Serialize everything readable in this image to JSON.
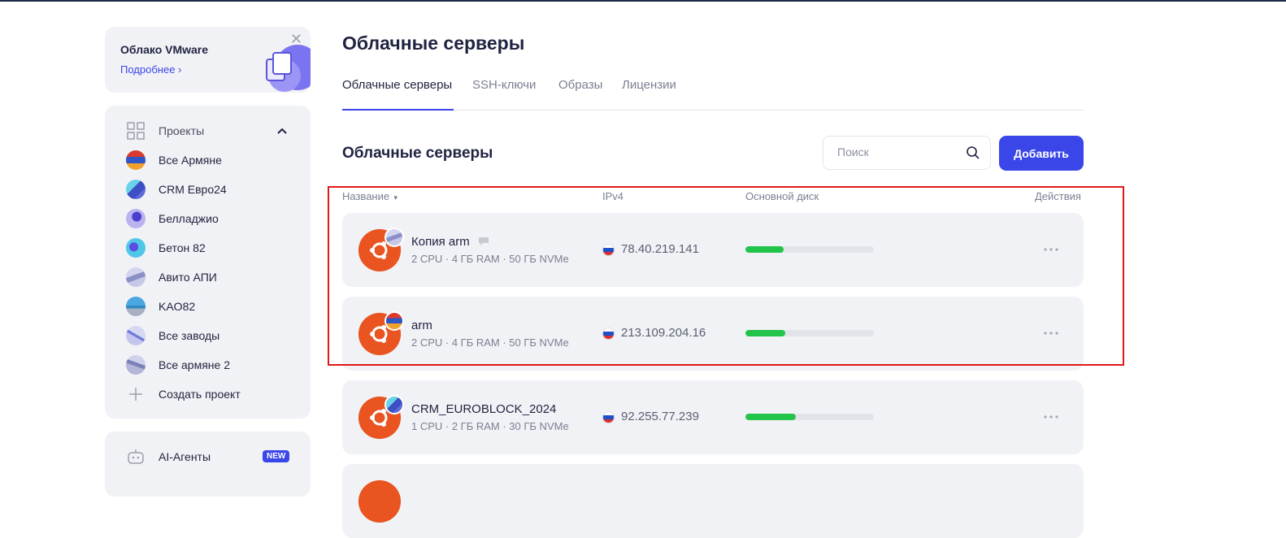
{
  "promo": {
    "title": "Облако VMware",
    "link": "Подробнее"
  },
  "projects": {
    "header": "Проекты",
    "items": [
      {
        "label": "Все Армяне",
        "avatar": "armenia-flag"
      },
      {
        "label": "CRM Евро24",
        "avatar": "blue-pattern"
      },
      {
        "label": "Белладжио",
        "avatar": "purple-pattern"
      },
      {
        "label": "Бетон 82",
        "avatar": "cyan-pattern"
      },
      {
        "label": "Авито АПИ",
        "avatar": "gray-pattern"
      },
      {
        "label": "KAO82",
        "avatar": "teal-pattern"
      },
      {
        "label": "Все заводы",
        "avatar": "lavender-pattern"
      },
      {
        "label": "Все армяне 2",
        "avatar": "slate-pattern"
      }
    ],
    "create": "Создать проект"
  },
  "ai": {
    "label": "AI-Агенты",
    "badge": "NEW"
  },
  "page": {
    "title": "Облачные серверы"
  },
  "tabs": [
    {
      "label": "Облачные серверы",
      "active": true
    },
    {
      "label": "SSH-ключи"
    },
    {
      "label": "Образы"
    },
    {
      "label": "Лицензии"
    }
  ],
  "section": {
    "title": "Облачные серверы"
  },
  "search": {
    "placeholder": "Поиск"
  },
  "add_button": "Добавить",
  "table": {
    "columns": {
      "name": "Название",
      "ip": "IPv4",
      "disk": "Основной диск",
      "actions": "Действия"
    },
    "rows": [
      {
        "name": "Копия arm",
        "spec": "2 CPU · 4 ГБ RAM · 50 ГБ NVMe",
        "ip": "78.40.219.141",
        "disk_usage": 0.3,
        "has_comment": true
      },
      {
        "name": "arm",
        "spec": "2 CPU · 4 ГБ RAM · 50 ГБ NVMe",
        "ip": "213.109.204.16",
        "disk_usage": 0.31,
        "has_comment": false
      },
      {
        "name": "CRM_EUROBLOCK_2024",
        "spec": "1 CPU · 2 ГБ RAM · 30 ГБ NVMe",
        "ip": "92.255.77.239",
        "disk_usage": 0.39,
        "has_comment": false
      }
    ]
  },
  "colors": {
    "accent": "#3b46e8",
    "ubuntu": "#e95420",
    "disk_fill": "#23c44a",
    "highlight": "#e01818"
  }
}
